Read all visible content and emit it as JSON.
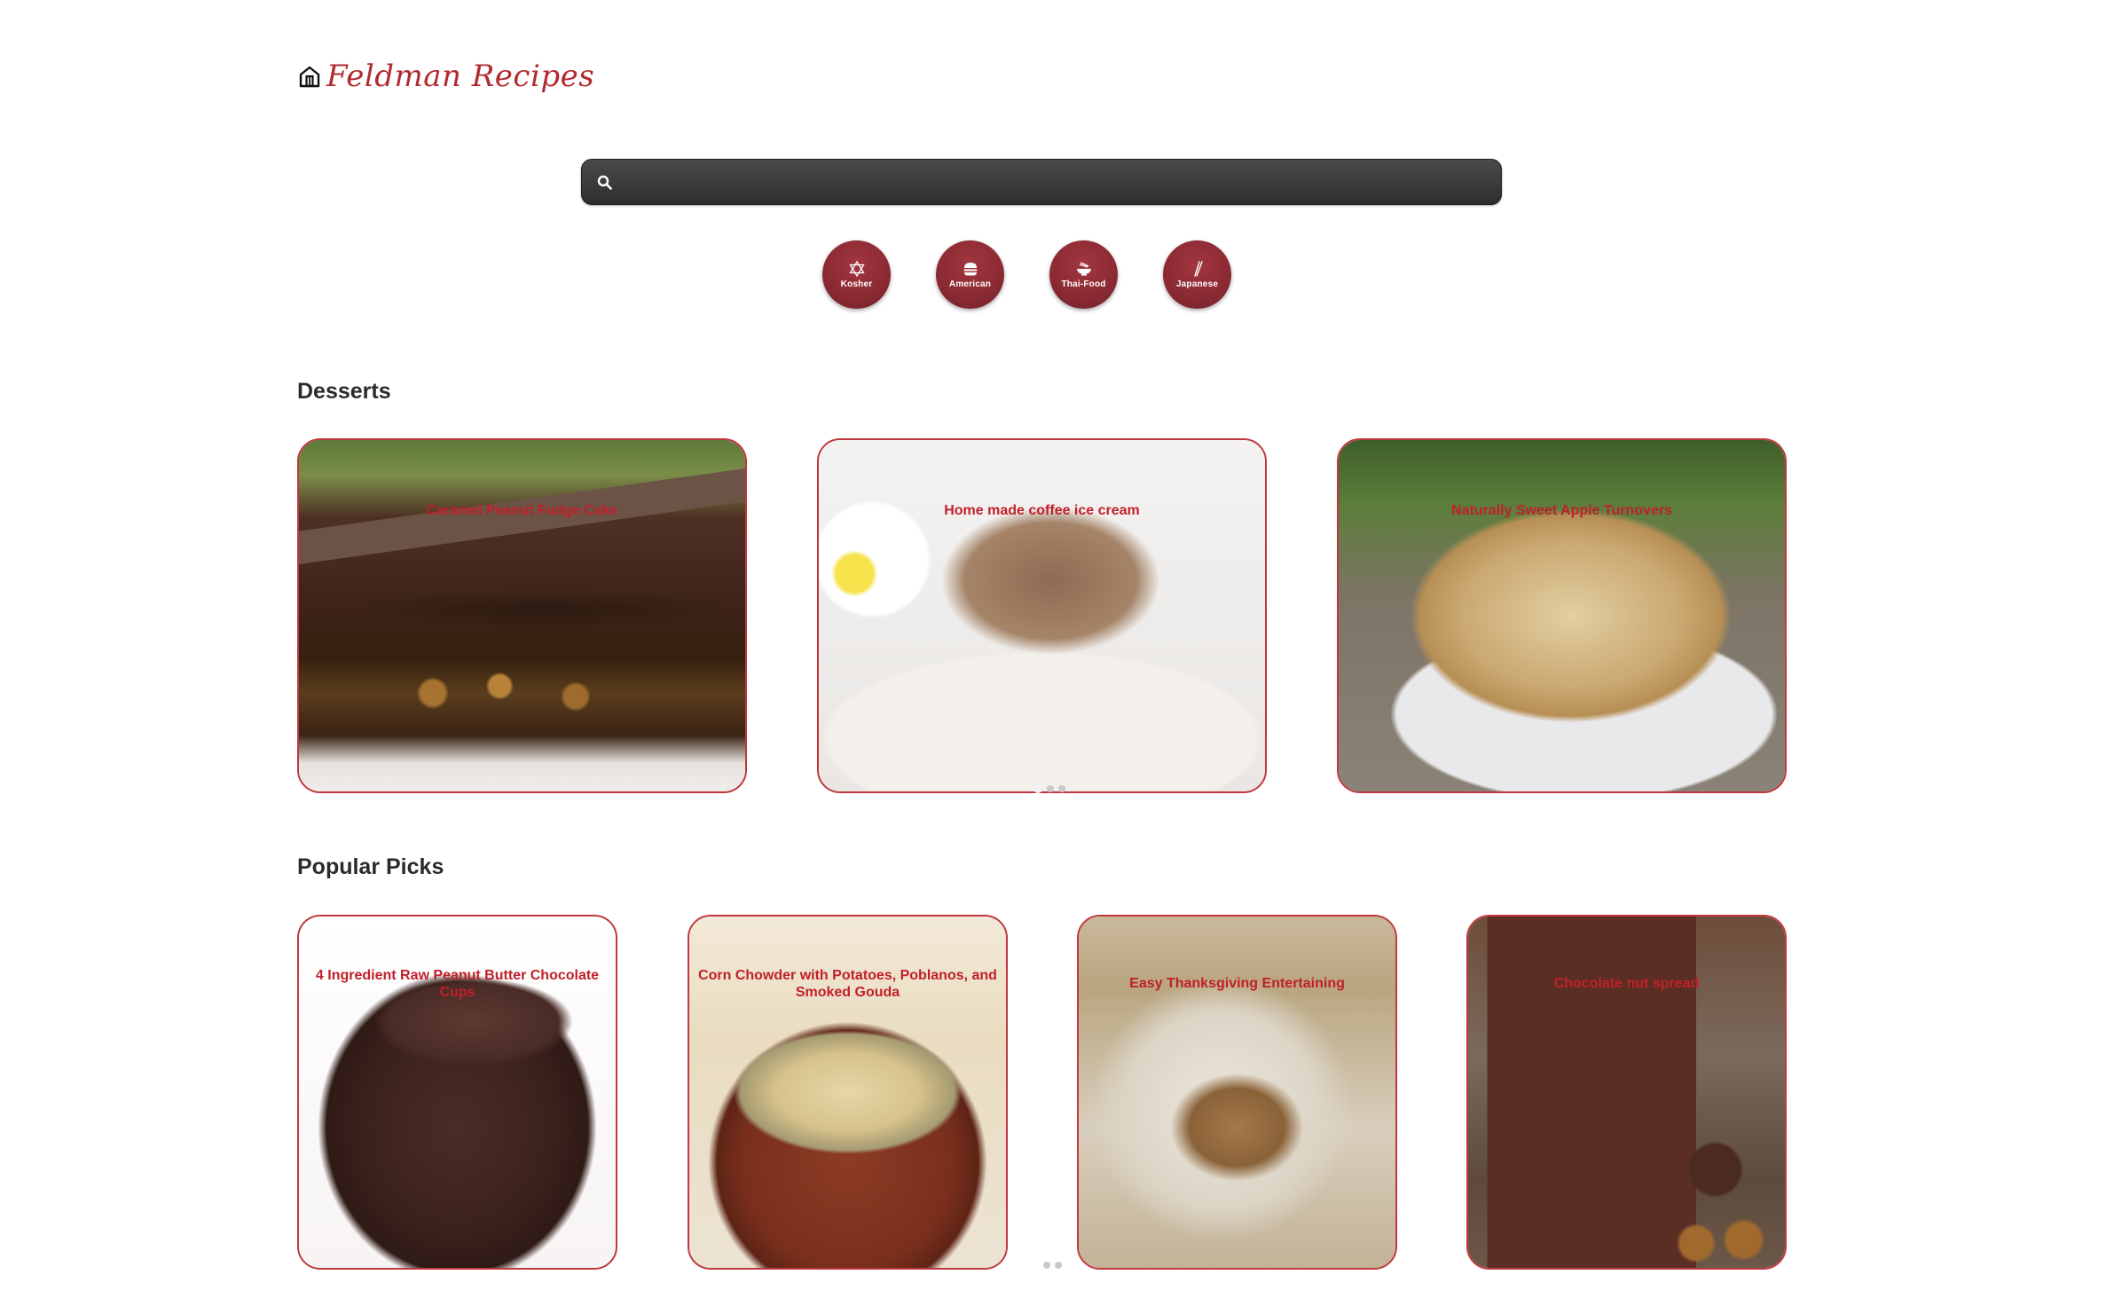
{
  "brand": {
    "name": "Feldman Recipes",
    "icon": "home-icon"
  },
  "search": {
    "placeholder": "",
    "value": "",
    "icon": "search-icon"
  },
  "cuisines": [
    {
      "label": "Kosher",
      "icon": "star-of-david-icon"
    },
    {
      "label": "American",
      "icon": "burger-icon"
    },
    {
      "label": "Thai-Food",
      "icon": "bowl-icon"
    },
    {
      "label": "Japanese",
      "icon": "chopsticks-icon"
    }
  ],
  "sections": {
    "desserts": {
      "title": "Desserts",
      "cards": [
        {
          "title": "Caramel Peanut Fudge Cake"
        },
        {
          "title": "Home made coffee ice cream"
        },
        {
          "title": "Naturally Sweet Apple Turnovers"
        }
      ]
    },
    "popular": {
      "title": "Popular Picks",
      "cards": [
        {
          "title": "4 Ingredient Raw Peanut Butter Chocolate Cups"
        },
        {
          "title": "Corn Chowder with Potatoes, Poblanos, and Smoked Gouda"
        },
        {
          "title": "Easy Thanksgiving Entertaining"
        },
        {
          "title": "Chocolate nut spread"
        }
      ]
    }
  },
  "colors": {
    "accent": "#c0202a",
    "card_border": "#c0383d",
    "cuisine_button": "#8a2a33",
    "search_bar": "#3a3a3a"
  }
}
